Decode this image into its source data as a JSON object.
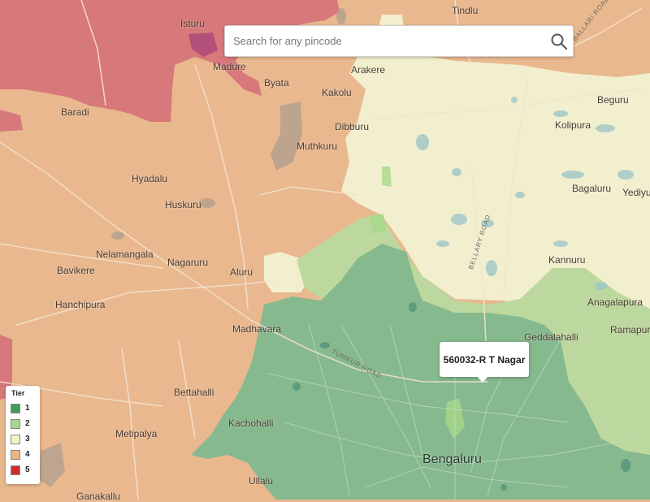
{
  "search": {
    "placeholder": "Search for any pincode"
  },
  "tooltip": {
    "text": "560032-R T Nagar"
  },
  "legend": {
    "title": "Tier",
    "items": [
      {
        "label": "1",
        "color": "#3f9a5b"
      },
      {
        "label": "2",
        "color": "#a8d88a"
      },
      {
        "label": "3",
        "color": "#f6f2c6"
      },
      {
        "label": "4",
        "color": "#f0b27f"
      },
      {
        "label": "5",
        "color": "#cf2b2b"
      }
    ]
  },
  "colors": {
    "tier1_fill": "#86b98e",
    "tier2_fill": "#bcd89e",
    "tier3_fill": "#f2efcf",
    "tier4_fill": "#e9b88f",
    "tier5_fill": "#d7787a"
  },
  "places": {
    "tindlu": "Tindlu",
    "isturu": "Isturu",
    "madure": "Madure",
    "arakere": "Arakere",
    "byata": "Byata",
    "kakolu": "Kakolu",
    "baradi": "Baradi",
    "beguru": "Beguru",
    "kolipura": "Kolipura",
    "dibburu": "Dibburu",
    "muthkuru": "Muthkuru",
    "hyadalu": "Hyadalu",
    "bagaluru": "Bagaluru",
    "yediyur": "Yediyur",
    "huskuru": "Huskuru",
    "nelamangala": "Nelamangala",
    "bavikere": "Bavikere",
    "nagaruru": "Nagaruru",
    "aluru": "Aluru",
    "kannuru": "Kannuru",
    "hanchipura": "Hanchipura",
    "anagalapura": "Anagalapura",
    "madhavara": "Madhavara",
    "ramapura": "Ramapura",
    "geddalahalli": "Geddalahalli",
    "bettahalli": "Bettahalli",
    "kachohalli": "Kachohalli",
    "metipalya": "Metipalya",
    "bengaluru": "Bengaluru",
    "ullalu": "Ullalu",
    "ganakallu": "Ganakallu"
  },
  "roads": {
    "ballari_north": "BALLARI ROAD",
    "bellary": "BELLARY ROAD",
    "tumkur": "TUMKUR ROAD"
  }
}
